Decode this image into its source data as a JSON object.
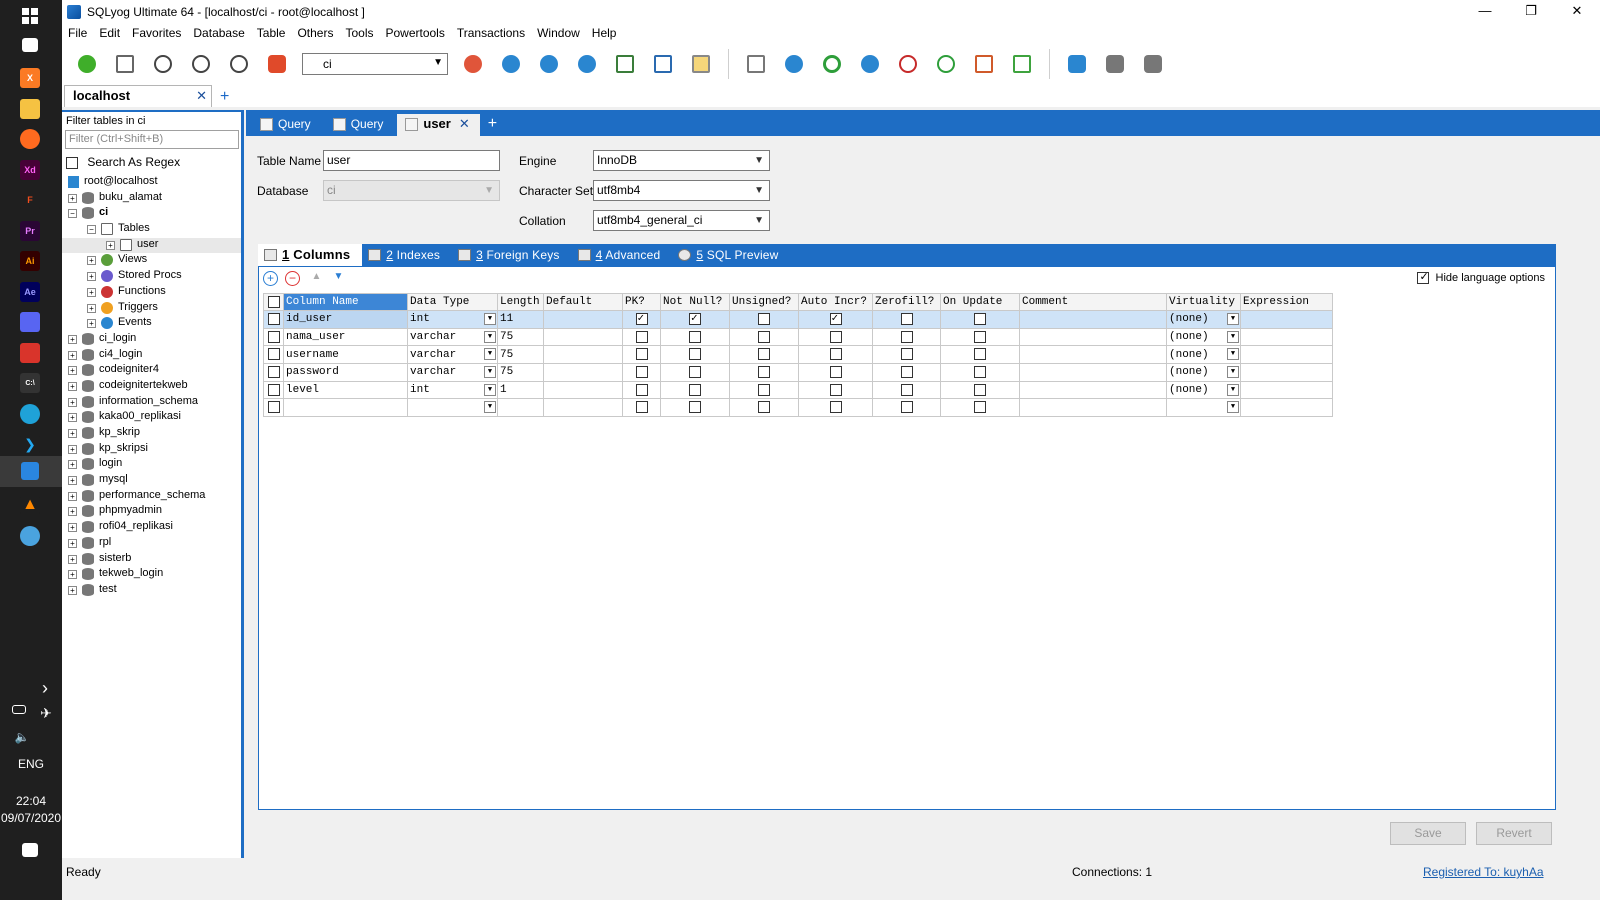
{
  "window": {
    "title": "SQLyog Ultimate 64 - [localhost/ci - root@localhost ]",
    "minimize": "—",
    "maximize": "❐",
    "close": "✕"
  },
  "menu": [
    "File",
    "Edit",
    "Favorites",
    "Database",
    "Table",
    "Others",
    "Tools",
    "Powertools",
    "Transactions",
    "Window",
    "Help"
  ],
  "toolbar": {
    "db_select": "ci"
  },
  "connection_tab": {
    "label": "localhost",
    "close": "✕",
    "add": "+"
  },
  "left": {
    "filter_label": "Filter tables in ci",
    "filter_placeholder": "Filter (Ctrl+Shift+B)",
    "regex_label": "Search As Regex",
    "root": "root@localhost",
    "tree": [
      {
        "label": "buku_alamat",
        "level": 0,
        "exp": "+"
      },
      {
        "label": "ci",
        "level": 0,
        "exp": "−",
        "bold": true
      },
      {
        "label": "Tables",
        "level": 1,
        "exp": "−"
      },
      {
        "label": "user",
        "level": 2,
        "exp": "+",
        "selected": true
      },
      {
        "label": "Views",
        "level": 1,
        "exp": "+"
      },
      {
        "label": "Stored Procs",
        "level": 1,
        "exp": "+"
      },
      {
        "label": "Functions",
        "level": 1,
        "exp": "+"
      },
      {
        "label": "Triggers",
        "level": 1,
        "exp": "+"
      },
      {
        "label": "Events",
        "level": 1,
        "exp": "+"
      },
      {
        "label": "ci_login",
        "level": 0,
        "exp": "+"
      },
      {
        "label": "ci4_login",
        "level": 0,
        "exp": "+"
      },
      {
        "label": "codeigniter4",
        "level": 0,
        "exp": "+"
      },
      {
        "label": "codeignitertekweb",
        "level": 0,
        "exp": "+"
      },
      {
        "label": "information_schema",
        "level": 0,
        "exp": "+"
      },
      {
        "label": "kaka00_replikasi",
        "level": 0,
        "exp": "+"
      },
      {
        "label": "kp_skrip",
        "level": 0,
        "exp": "+"
      },
      {
        "label": "kp_skripsi",
        "level": 0,
        "exp": "+"
      },
      {
        "label": "login",
        "level": 0,
        "exp": "+"
      },
      {
        "label": "mysql",
        "level": 0,
        "exp": "+"
      },
      {
        "label": "performance_schema",
        "level": 0,
        "exp": "+"
      },
      {
        "label": "phpmyadmin",
        "level": 0,
        "exp": "+"
      },
      {
        "label": "rofi04_replikasi",
        "level": 0,
        "exp": "+"
      },
      {
        "label": "rpl",
        "level": 0,
        "exp": "+"
      },
      {
        "label": "sisterb",
        "level": 0,
        "exp": "+"
      },
      {
        "label": "tekweb_login",
        "level": 0,
        "exp": "+"
      },
      {
        "label": "test",
        "level": 0,
        "exp": "+"
      }
    ]
  },
  "query_tabs": [
    {
      "label": "Query",
      "active": false
    },
    {
      "label": "Query",
      "active": false
    },
    {
      "label": "user",
      "active": true
    }
  ],
  "form": {
    "table_name_label": "Table Name",
    "table_name": "user",
    "database_label": "Database",
    "database": "ci",
    "engine_label": "Engine",
    "engine": "InnoDB",
    "charset_label": "Character Set",
    "charset": "utf8mb4",
    "collation_label": "Collation",
    "collation": "utf8mb4_general_ci"
  },
  "subtabs": [
    {
      "num": "1",
      "label": " Columns",
      "active": true
    },
    {
      "num": "2",
      "label": " Indexes",
      "active": false
    },
    {
      "num": "3",
      "label": " Foreign Keys",
      "active": false
    },
    {
      "num": "4",
      "label": " Advanced",
      "active": false
    },
    {
      "num": "5",
      "label": " SQL Preview",
      "active": false
    }
  ],
  "hide_language_options": "Hide language options",
  "columns_header": [
    "Column Name",
    "Data Type",
    "Length",
    "Default",
    "PK?",
    "Not Null?",
    "Unsigned?",
    "Auto Incr?",
    "Zerofill?",
    "On Update",
    "Comment",
    "Virtuality",
    "Expression"
  ],
  "columns": [
    {
      "name": "id_user",
      "type": "int",
      "length": "11",
      "default": "",
      "pk": true,
      "notnull": true,
      "unsigned": false,
      "autoinc": true,
      "zerofill": false,
      "onupdate": false,
      "comment": "",
      "virtuality": "(none)",
      "expression": ""
    },
    {
      "name": "nama_user",
      "type": "varchar",
      "length": "75",
      "default": "",
      "pk": false,
      "notnull": false,
      "unsigned": false,
      "autoinc": false,
      "zerofill": false,
      "onupdate": false,
      "comment": "",
      "virtuality": "(none)",
      "expression": ""
    },
    {
      "name": "username",
      "type": "varchar",
      "length": "75",
      "default": "",
      "pk": false,
      "notnull": false,
      "unsigned": false,
      "autoinc": false,
      "zerofill": false,
      "onupdate": false,
      "comment": "",
      "virtuality": "(none)",
      "expression": ""
    },
    {
      "name": "password",
      "type": "varchar",
      "length": "75",
      "default": "",
      "pk": false,
      "notnull": false,
      "unsigned": false,
      "autoinc": false,
      "zerofill": false,
      "onupdate": false,
      "comment": "",
      "virtuality": "(none)",
      "expression": ""
    },
    {
      "name": "level",
      "type": "int",
      "length": "1",
      "default": "",
      "pk": false,
      "notnull": false,
      "unsigned": false,
      "autoinc": false,
      "zerofill": false,
      "onupdate": false,
      "comment": "",
      "virtuality": "(none)",
      "expression": ""
    },
    {
      "name": "",
      "type": "",
      "length": "",
      "default": "",
      "pk": false,
      "notnull": false,
      "unsigned": false,
      "autoinc": false,
      "zerofill": false,
      "onupdate": false,
      "comment": "",
      "virtuality": "",
      "expression": ""
    }
  ],
  "buttons": {
    "save": "Save",
    "revert": "Revert"
  },
  "status": {
    "left": "Ready",
    "connections": "Connections: 1",
    "registered": "Registered To: kuyhAa"
  },
  "taskbar": {
    "lang": "ENG",
    "time": "22:04",
    "date": "09/07/2020",
    "chevron": "›"
  },
  "colors": {
    "accent": "#1e6dc4",
    "taskbar": "#1f1f1f"
  }
}
